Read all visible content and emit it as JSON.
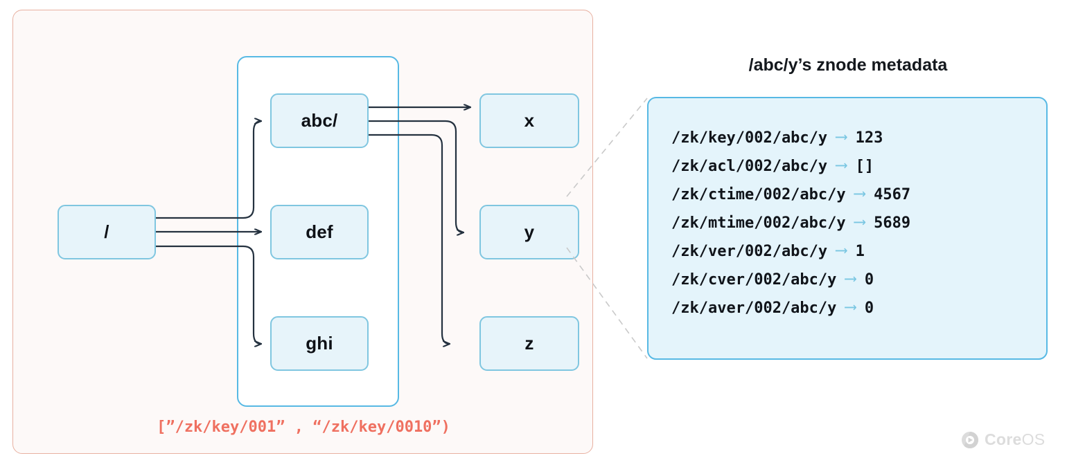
{
  "diagram": {
    "tree": {
      "nodes": [
        {
          "id": "root",
          "label": "/"
        },
        {
          "id": "abc",
          "label": "abc/"
        },
        {
          "id": "def",
          "label": "def"
        },
        {
          "id": "ghi",
          "label": "ghi"
        },
        {
          "id": "x",
          "label": "x"
        },
        {
          "id": "y",
          "label": "y"
        },
        {
          "id": "z",
          "label": "z"
        }
      ],
      "edges": [
        {
          "from": "root",
          "to": "abc"
        },
        {
          "from": "root",
          "to": "def"
        },
        {
          "from": "root",
          "to": "ghi"
        },
        {
          "from": "abc",
          "to": "x"
        },
        {
          "from": "abc",
          "to": "y"
        },
        {
          "from": "abc",
          "to": "z"
        }
      ]
    },
    "range_caption": "[”/zk/key/001” , “/zk/key/0010”)",
    "colors": {
      "outer_border": "#e8b0a0",
      "inner_border": "#57b9e4",
      "node_fill": "#e7f4fa",
      "node_border": "#7fc6e0",
      "edge_line": "#24313f",
      "caption_text": "#ef7060",
      "panel_fill": "#e4f4fb",
      "panel_border": "#57b9e4",
      "meta_arrow": "#79c6e2",
      "callout_dash": "#c9c9c9"
    }
  },
  "metadata": {
    "title": "/abc/y’s znode metadata",
    "arrow_glyph": "⟶",
    "rows": [
      {
        "key": "/zk/key/002/abc/y",
        "value": "123"
      },
      {
        "key": "/zk/acl/002/abc/y",
        "value": "[]"
      },
      {
        "key": "/zk/ctime/002/abc/y",
        "value": "4567"
      },
      {
        "key": "/zk/mtime/002/abc/y",
        "value": "5689"
      },
      {
        "key": "/zk/ver/002/abc/y",
        "value": "1"
      },
      {
        "key": "/zk/cver/002/abc/y",
        "value": "0"
      },
      {
        "key": "/zk/aver/002/abc/y",
        "value": "0"
      }
    ]
  },
  "branding": {
    "core": "Core",
    "os": "OS"
  }
}
